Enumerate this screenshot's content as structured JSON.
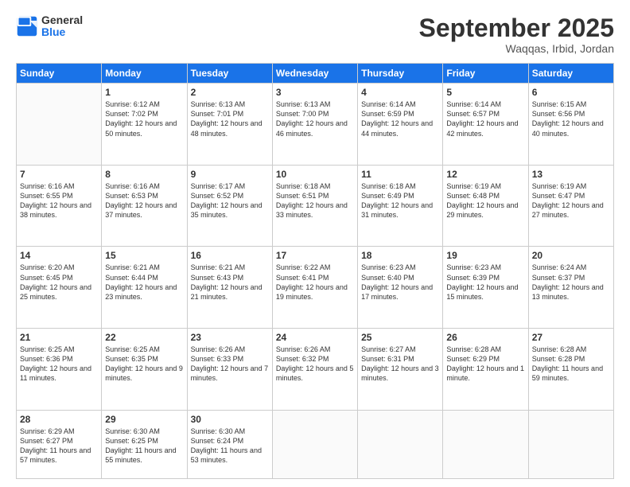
{
  "header": {
    "logo_general": "General",
    "logo_blue": "Blue",
    "month_title": "September 2025",
    "location": "Waqqas, Irbid, Jordan"
  },
  "days_of_week": [
    "Sunday",
    "Monday",
    "Tuesday",
    "Wednesday",
    "Thursday",
    "Friday",
    "Saturday"
  ],
  "weeks": [
    [
      {
        "day": "",
        "content": ""
      },
      {
        "day": "1",
        "content": "Sunrise: 6:12 AM\nSunset: 7:02 PM\nDaylight: 12 hours\nand 50 minutes."
      },
      {
        "day": "2",
        "content": "Sunrise: 6:13 AM\nSunset: 7:01 PM\nDaylight: 12 hours\nand 48 minutes."
      },
      {
        "day": "3",
        "content": "Sunrise: 6:13 AM\nSunset: 7:00 PM\nDaylight: 12 hours\nand 46 minutes."
      },
      {
        "day": "4",
        "content": "Sunrise: 6:14 AM\nSunset: 6:59 PM\nDaylight: 12 hours\nand 44 minutes."
      },
      {
        "day": "5",
        "content": "Sunrise: 6:14 AM\nSunset: 6:57 PM\nDaylight: 12 hours\nand 42 minutes."
      },
      {
        "day": "6",
        "content": "Sunrise: 6:15 AM\nSunset: 6:56 PM\nDaylight: 12 hours\nand 40 minutes."
      }
    ],
    [
      {
        "day": "7",
        "content": "Sunrise: 6:16 AM\nSunset: 6:55 PM\nDaylight: 12 hours\nand 38 minutes."
      },
      {
        "day": "8",
        "content": "Sunrise: 6:16 AM\nSunset: 6:53 PM\nDaylight: 12 hours\nand 37 minutes."
      },
      {
        "day": "9",
        "content": "Sunrise: 6:17 AM\nSunset: 6:52 PM\nDaylight: 12 hours\nand 35 minutes."
      },
      {
        "day": "10",
        "content": "Sunrise: 6:18 AM\nSunset: 6:51 PM\nDaylight: 12 hours\nand 33 minutes."
      },
      {
        "day": "11",
        "content": "Sunrise: 6:18 AM\nSunset: 6:49 PM\nDaylight: 12 hours\nand 31 minutes."
      },
      {
        "day": "12",
        "content": "Sunrise: 6:19 AM\nSunset: 6:48 PM\nDaylight: 12 hours\nand 29 minutes."
      },
      {
        "day": "13",
        "content": "Sunrise: 6:19 AM\nSunset: 6:47 PM\nDaylight: 12 hours\nand 27 minutes."
      }
    ],
    [
      {
        "day": "14",
        "content": "Sunrise: 6:20 AM\nSunset: 6:45 PM\nDaylight: 12 hours\nand 25 minutes."
      },
      {
        "day": "15",
        "content": "Sunrise: 6:21 AM\nSunset: 6:44 PM\nDaylight: 12 hours\nand 23 minutes."
      },
      {
        "day": "16",
        "content": "Sunrise: 6:21 AM\nSunset: 6:43 PM\nDaylight: 12 hours\nand 21 minutes."
      },
      {
        "day": "17",
        "content": "Sunrise: 6:22 AM\nSunset: 6:41 PM\nDaylight: 12 hours\nand 19 minutes."
      },
      {
        "day": "18",
        "content": "Sunrise: 6:23 AM\nSunset: 6:40 PM\nDaylight: 12 hours\nand 17 minutes."
      },
      {
        "day": "19",
        "content": "Sunrise: 6:23 AM\nSunset: 6:39 PM\nDaylight: 12 hours\nand 15 minutes."
      },
      {
        "day": "20",
        "content": "Sunrise: 6:24 AM\nSunset: 6:37 PM\nDaylight: 12 hours\nand 13 minutes."
      }
    ],
    [
      {
        "day": "21",
        "content": "Sunrise: 6:25 AM\nSunset: 6:36 PM\nDaylight: 12 hours\nand 11 minutes."
      },
      {
        "day": "22",
        "content": "Sunrise: 6:25 AM\nSunset: 6:35 PM\nDaylight: 12 hours\nand 9 minutes."
      },
      {
        "day": "23",
        "content": "Sunrise: 6:26 AM\nSunset: 6:33 PM\nDaylight: 12 hours\nand 7 minutes."
      },
      {
        "day": "24",
        "content": "Sunrise: 6:26 AM\nSunset: 6:32 PM\nDaylight: 12 hours\nand 5 minutes."
      },
      {
        "day": "25",
        "content": "Sunrise: 6:27 AM\nSunset: 6:31 PM\nDaylight: 12 hours\nand 3 minutes."
      },
      {
        "day": "26",
        "content": "Sunrise: 6:28 AM\nSunset: 6:29 PM\nDaylight: 12 hours\nand 1 minute."
      },
      {
        "day": "27",
        "content": "Sunrise: 6:28 AM\nSunset: 6:28 PM\nDaylight: 11 hours\nand 59 minutes."
      }
    ],
    [
      {
        "day": "28",
        "content": "Sunrise: 6:29 AM\nSunset: 6:27 PM\nDaylight: 11 hours\nand 57 minutes."
      },
      {
        "day": "29",
        "content": "Sunrise: 6:30 AM\nSunset: 6:25 PM\nDaylight: 11 hours\nand 55 minutes."
      },
      {
        "day": "30",
        "content": "Sunrise: 6:30 AM\nSunset: 6:24 PM\nDaylight: 11 hours\nand 53 minutes."
      },
      {
        "day": "",
        "content": ""
      },
      {
        "day": "",
        "content": ""
      },
      {
        "day": "",
        "content": ""
      },
      {
        "day": "",
        "content": ""
      }
    ]
  ]
}
